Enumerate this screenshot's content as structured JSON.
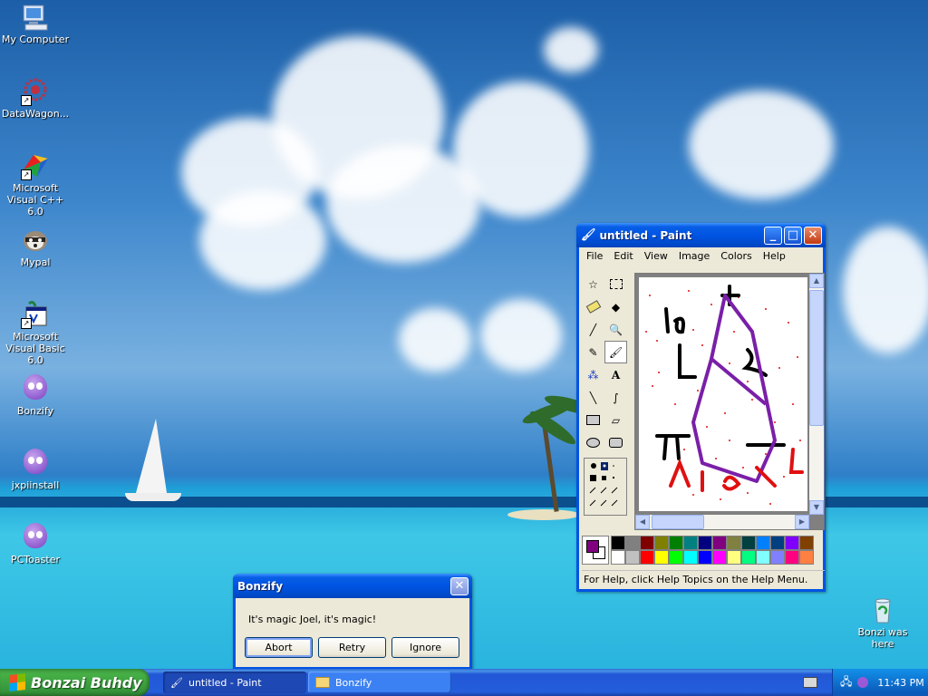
{
  "desktop": {
    "icons": [
      {
        "label": "My Computer",
        "icon": "my-computer-icon"
      },
      {
        "label": "DataWagon...",
        "icon": "datawagon-icon"
      },
      {
        "label": "Microsoft Visual C++ 6.0",
        "icon": "visual-cpp-icon"
      },
      {
        "label": "Mypal",
        "icon": "mypal-icon"
      },
      {
        "label": "Microsoft Visual Basic 6.0",
        "icon": "visual-basic-icon"
      },
      {
        "label": "Bonzify",
        "icon": "bonzi-icon"
      },
      {
        "label": "jxpiinstall",
        "icon": "bonzi-icon"
      },
      {
        "label": "PCToaster",
        "icon": "bonzi-icon"
      }
    ],
    "recycle_bin": {
      "label": "Bonzi was here",
      "icon": "recycle-bin-icon"
    }
  },
  "paint": {
    "title": "untitled - Paint",
    "menu": [
      "File",
      "Edit",
      "View",
      "Image",
      "Colors",
      "Help"
    ],
    "tools": [
      "free-form-select",
      "select",
      "eraser",
      "fill",
      "pick-color",
      "magnifier",
      "pencil",
      "brush",
      "airbrush",
      "text",
      "line",
      "curve",
      "rectangle",
      "polygon",
      "ellipse",
      "rounded-rectangle"
    ],
    "selected_tool": "brush",
    "canvas_text": {
      "line1": "idont",
      "line2": "LIKE",
      "line3": "IT",
      "line4": "AFAL"
    },
    "foreground_color": "#800080",
    "background_color": "#ffffff",
    "palette_colors": [
      "#000000",
      "#808080",
      "#800000",
      "#808000",
      "#008000",
      "#008080",
      "#000080",
      "#800080",
      "#808040",
      "#004040",
      "#0080ff",
      "#004080",
      "#8000ff",
      "#804000",
      "#ffffff",
      "#c0c0c0",
      "#ff0000",
      "#ffff00",
      "#00ff00",
      "#00ffff",
      "#0000ff",
      "#ff00ff",
      "#ffff80",
      "#00ff80",
      "#80ffff",
      "#8080ff",
      "#ff0080",
      "#ff8040"
    ],
    "status": "For Help, click Help Topics on the Help Menu."
  },
  "dialog": {
    "title": "Bonzify",
    "message": "It's magic Joel, it's magic!",
    "buttons": [
      "Abort",
      "Retry",
      "Ignore"
    ]
  },
  "taskbar": {
    "start_label": "Bonzai Buhdy",
    "tasks": [
      {
        "label": "untitled - Paint",
        "active": true
      },
      {
        "label": "Bonzify",
        "active": false
      }
    ],
    "clock": "11:43 PM"
  }
}
